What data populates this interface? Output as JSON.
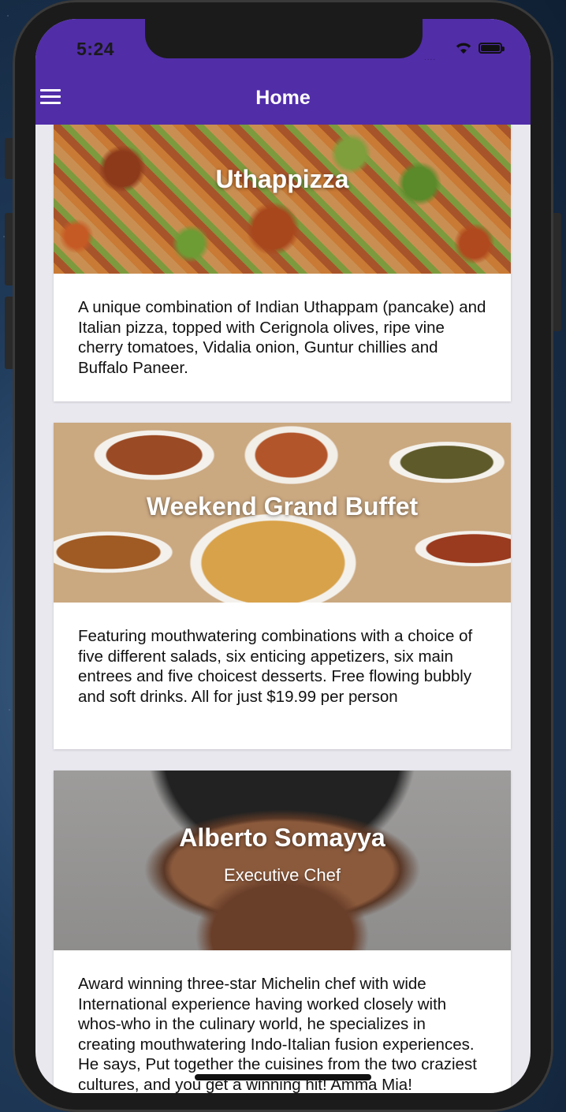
{
  "status_bar": {
    "time": "5:24",
    "signal": "....",
    "wifi_icon": "wifi-icon",
    "battery_icon": "battery-full-icon"
  },
  "header": {
    "title": "Home",
    "menu_icon": "hamburger-menu-icon",
    "color": "#512da8"
  },
  "cards": [
    {
      "title": "Uthappizza",
      "subtitle": "",
      "description": "A unique combination of Indian Uthappam (pancake) and Italian pizza, topped with Cerignola olives, ripe vine cherry tomatoes, Vidalia onion, Guntur chillies and Buffalo Paneer.",
      "image": "pizza-photo"
    },
    {
      "title": "Weekend Grand Buffet",
      "subtitle": "",
      "description": "Featuring mouthwatering combinations with a choice of five different salads, six enticing appetizers, six main entrees and five choicest desserts. Free flowing bubbly and soft drinks. All for just $19.99 per person",
      "image": "buffet-photo"
    },
    {
      "title": "Alberto Somayya",
      "subtitle": "Executive Chef",
      "description": "Award winning three-star Michelin chef with wide International experience having worked closely with whos-who in the culinary world, he specializes in creating mouthwatering Indo-Italian fusion experiences. He says, Put together the cuisines from the two craziest cultures, and you get a winning hit! Amma Mia!",
      "image": "chef-photo"
    }
  ]
}
